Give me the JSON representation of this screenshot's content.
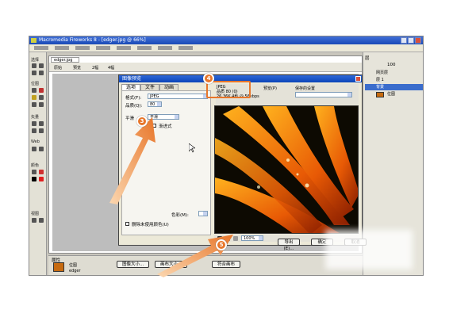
{
  "caption": "",
  "app": {
    "title": "Macromedia Fireworks 8 - [edger.jpg @ 66%]",
    "doc_tab": "edger.jpg",
    "doc_strip": {
      "original": "原始",
      "preview": "预览",
      "twoup": "2幅",
      "fourup": "4幅"
    }
  },
  "toolbox": {
    "sections": [
      "选择",
      "位图",
      "矢量",
      "Web",
      "颜色",
      "视图"
    ]
  },
  "dialog": {
    "title": "图像预览",
    "tabs": [
      "选项",
      "文件",
      "动画"
    ],
    "format_label": "格式(F):",
    "format_value": "JPEG",
    "quality_label": "品质(Q):",
    "quality_value": "80",
    "smoothing_label": "平滑",
    "smoothing_value": "平滑",
    "progressive": "渐进式",
    "color_label": "色彩(M):",
    "remove_color_label": "删除未使用颜色(U)",
    "preview_info": {
      "format": "JPEG",
      "quality": "品质 80 (0)",
      "size": "26.36K 4秒 @ 56kbps"
    },
    "preview_check": "预览(P)",
    "saved_settings": "保存的设置",
    "zoom": "100%",
    "export_button": "导出(E)...",
    "ok_button": "确定",
    "cancel_button": "取消"
  },
  "right_panel": {
    "layers_title": "层",
    "layers": [
      {
        "name": "网页层",
        "selected": false
      },
      {
        "name": "层 1",
        "selected": false
      },
      {
        "name": "背景",
        "selected": true
      },
      {
        "name": "位图",
        "selected": false
      }
    ],
    "opacity": "100"
  },
  "props": {
    "title": "属性",
    "object": "位图",
    "name": "edger",
    "btn1": "图像大小...",
    "btn2": "画布大小...",
    "btn3": "符合画布"
  },
  "annotations": {
    "badge3": "3",
    "badge4": "4",
    "badge5": "5"
  },
  "colors": {
    "accent_orange": "#e8762a",
    "title_blue": "#1b4bb6"
  }
}
